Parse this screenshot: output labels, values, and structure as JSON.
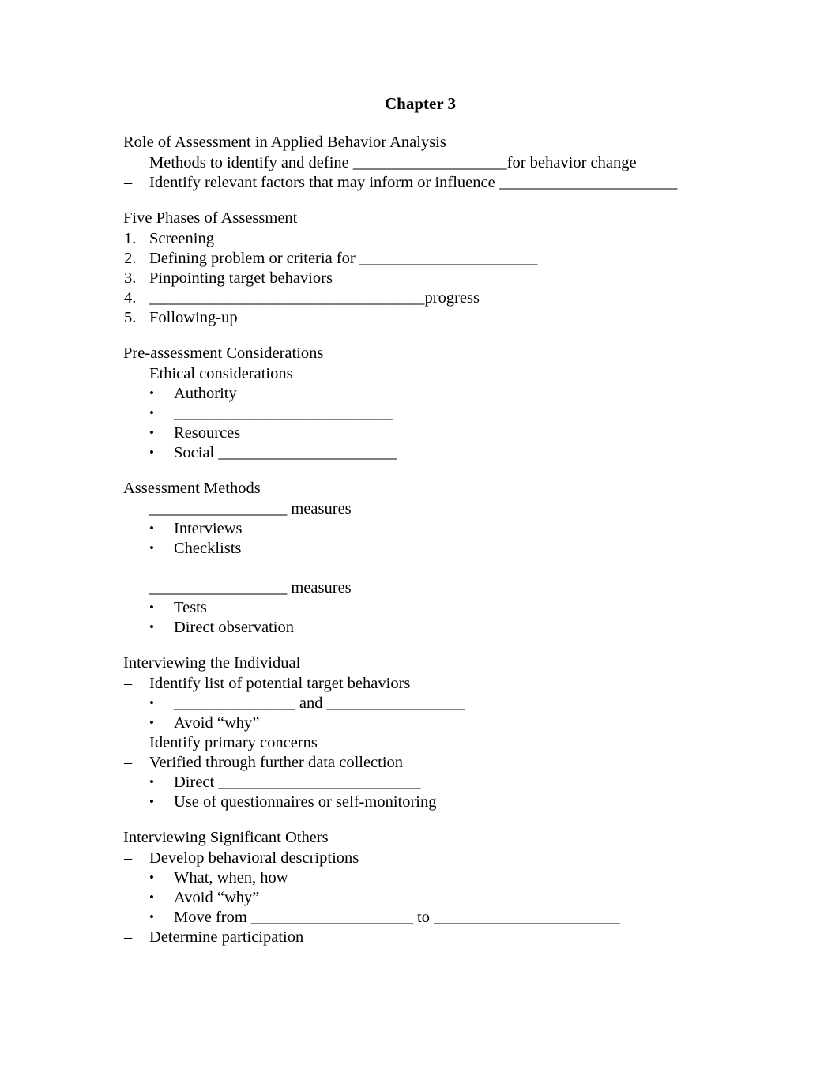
{
  "document": {
    "title": "Chapter 3",
    "markers": {
      "dash": "–",
      "bullet": "•"
    },
    "sections": [
      {
        "heading": "Role of Assessment in Applied Behavior Analysis",
        "items": [
          {
            "type": "dash",
            "text": "Methods to identify and define ___________________for behavior change"
          },
          {
            "type": "dash",
            "text": "Identify relevant factors that may inform or influence ______________________"
          }
        ]
      },
      {
        "heading": "Five Phases of Assessment",
        "items": [
          {
            "type": "num",
            "marker": "1.",
            "text": "Screening"
          },
          {
            "type": "num",
            "marker": "2.",
            "text": "Defining problem or criteria for ______________________"
          },
          {
            "type": "num",
            "marker": "3.",
            "text": "Pinpointing target behaviors"
          },
          {
            "type": "num",
            "marker": "4.",
            "text": "__________________________________progress"
          },
          {
            "type": "num",
            "marker": "5.",
            "text": "Following-up"
          }
        ]
      },
      {
        "heading": "Pre-assessment Considerations",
        "items": [
          {
            "type": "dash",
            "text": "Ethical considerations"
          },
          {
            "type": "bullet",
            "text": "Authority"
          },
          {
            "type": "bullet",
            "text": "___________________________"
          },
          {
            "type": "bullet",
            "text": "Resources"
          },
          {
            "type": "bullet",
            "text": "Social ______________________"
          }
        ]
      },
      {
        "heading": "Assessment Methods",
        "items": [
          {
            "type": "dash",
            "text": "_________________ measures"
          },
          {
            "type": "bullet",
            "text": "Interviews"
          },
          {
            "type": "bullet",
            "text": "Checklists"
          },
          {
            "type": "blank",
            "text": ""
          },
          {
            "type": "dash",
            "text": "_________________ measures"
          },
          {
            "type": "bullet",
            "text": "Tests"
          },
          {
            "type": "bullet",
            "text": "Direct observation"
          }
        ]
      },
      {
        "heading": "Interviewing the Individual",
        "items": [
          {
            "type": "dash",
            "text": "Identify list of potential target behaviors"
          },
          {
            "type": "bullet",
            "text": "_______________ and _________________"
          },
          {
            "type": "bullet",
            "text": "Avoid “why”"
          },
          {
            "type": "dash",
            "text": "Identify primary concerns"
          },
          {
            "type": "dash",
            "text": "Verified through further data collection"
          },
          {
            "type": "bullet",
            "text": "Direct _________________________"
          },
          {
            "type": "bullet",
            "text": "Use of questionnaires or self-monitoring"
          }
        ]
      },
      {
        "heading": "Interviewing Significant Others",
        "items": [
          {
            "type": "dash",
            "text": "Develop behavioral descriptions"
          },
          {
            "type": "bullet",
            "text": "What, when, how"
          },
          {
            "type": "bullet",
            "text": "Avoid “why”"
          },
          {
            "type": "bullet",
            "text": "Move from ____________________ to _______________________"
          },
          {
            "type": "dash",
            "text": "Determine participation"
          }
        ]
      }
    ]
  }
}
